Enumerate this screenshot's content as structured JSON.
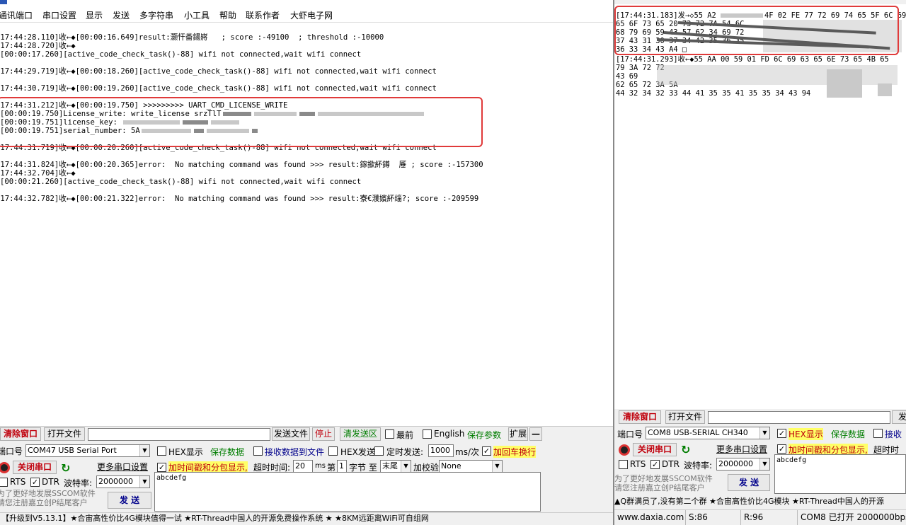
{
  "left": {
    "menu": [
      "通讯端口",
      "串口设置",
      "显示",
      "发送",
      "多字符串",
      "小工具",
      "帮助",
      "联系作者",
      "大虾电子网"
    ],
    "log_lines": [
      "[17:44:28.110]收←◆[00:00:16.649]result:灏忓畨鍚嶈   ; score :-49100  ; threshold :-10000",
      "[17:44:28.720]收←◆",
      "[00:00:17.260][active_code_check_task()-88] wifi not connected,wait wifi connect",
      "[17:44:29.719]收←◆[00:00:18.260][active_code_check_task()-88] wifi not connected,wait wifi connect",
      "[17:44:30.719]收←◆[00:00:19.260][active_code_check_task()-88] wifi not connected,wait wifi connect",
      "[17:44:31.212]收←◆[00:00:19.750] >>>>>>>>> UART_CMD_LICENSE_WRITE",
      "[00:00:19.750]License_write: write_license srzTlT",
      "[00:00:19.751]license_key: ",
      "[00:00:19.751]serial_number: 5A",
      "[17:44:31.719]收←◆[00:00:20.260][active_code_check_task()-88] wifi not connected,wait wifi connect",
      "[17:44:31.824]收←◆[00:00:20.365]error:  No matching command was found >>> result:鎵撳紑鐏  厜 ; score :-157300",
      "[17:44:32.704]收←◆",
      "[00:00:21.260][active_code_check_task()-88] wifi not connected,wait wifi connect",
      "[17:44:32.782]收←◆[00:00:21.322]error:  No matching command was found >>> result:寮€濮嬪紑缁?; score :-209599"
    ],
    "toolbar": {
      "clear": "清除窗口",
      "open_file": "打开文件",
      "send_file": "发送文件",
      "stop": "停止",
      "clear_send": "清发送区",
      "topmost": "最前",
      "english": "English",
      "save_params": "保存参数",
      "expand": "扩展",
      "minus": "—"
    },
    "port": {
      "label": "端口号",
      "value": "COM47 USB Serial Port",
      "close_btn": "关闭串口",
      "more_settings": "更多串口设置",
      "rts": "RTS",
      "dtr": "DTR",
      "baud_label": "波特率:",
      "baud": "2000000"
    },
    "options": {
      "hex_display": "HEX显示",
      "save_data": "保存数据",
      "recv_to_file": "接收数据到文件",
      "hex_send": "HEX发送",
      "timed_send": "定时发送:",
      "interval": "1000",
      "interval_unit": "ms/次",
      "add_crlf": "加回车换行",
      "add_timestamp": "加时间戳和分包显示,",
      "timeout_label": "超时时间:",
      "timeout": "20",
      "ms": "ms",
      "nth": "第",
      "nth_val": "1",
      "byte_to": "字节 至",
      "end": "末尾",
      "checksum_label": "加校验",
      "checksum": "None"
    },
    "send_text": "abcdefg",
    "send_btn": "发 送",
    "promo": "为了更好地发展SSCOM软件\n请您注册嘉立创P结尾客户",
    "status": "【升级到V5.13.1】★合宙高性价比4G模块值得一试 ★RT-Thread中国人的开源免费操作系统 ★ ★8KM远距离WiFi可自组网"
  },
  "right": {
    "log_lines": [
      "[17:44:31.183]发→◇55 A2 ",
      "65 6F 73 65 20 73 72 7A 54 6C",
      "68 79 69 59 43 57 62 34 69 72",
      "37 43 31 30 37 34 42 35 36 35",
      "36 33 34 43 A4 □",
      "[17:44:31.293]收←◆55 AA 00 59 01 FD 6C 69 63 65 6E 73 65 4B 65",
      "79 3A 72 72 ",
      "43 69 ",
      "62 65 72 3A 5A",
      "44 32 34 32 33 44 41 35 35 41 35 35 34 43 94"
    ],
    "toolbar": {
      "clear": "清除窗口",
      "open_file": "打开文件",
      "send": "发"
    },
    "port": {
      "label": "端口号",
      "value": "COM8 USB-SERIAL CH340",
      "close_btn": "关闭串口",
      "more_settings": "更多串口设置",
      "rts": "RTS",
      "dtr": "DTR",
      "baud_label": "波特率:",
      "baud": "2000000"
    },
    "options": {
      "hex_display": "HEX显示",
      "save_data": "保存数据",
      "recv": "接收",
      "add_timestamp": "加时间戳和分包显示,",
      "timeout_label": "超时时"
    },
    "send_text": "abcdefg",
    "send_btn": "发 送",
    "promo": "为了更好地发展SSCOM软件\n请您注册嘉立创P结尾客户",
    "status_bar": "▲Q群满员了,没有第二个群 ★合宙高性价比4G模块 ★RT-Thread中国人的开源",
    "status": {
      "site": "www.daxia.com",
      "s": "S:86",
      "r": "R:96",
      "com": "COM8 已打开  2000000bps"
    }
  },
  "colors": {
    "red_box": "#e03a3a",
    "highlight": "#ffff66",
    "green": "#007d00",
    "red_text": "#c0000c"
  }
}
